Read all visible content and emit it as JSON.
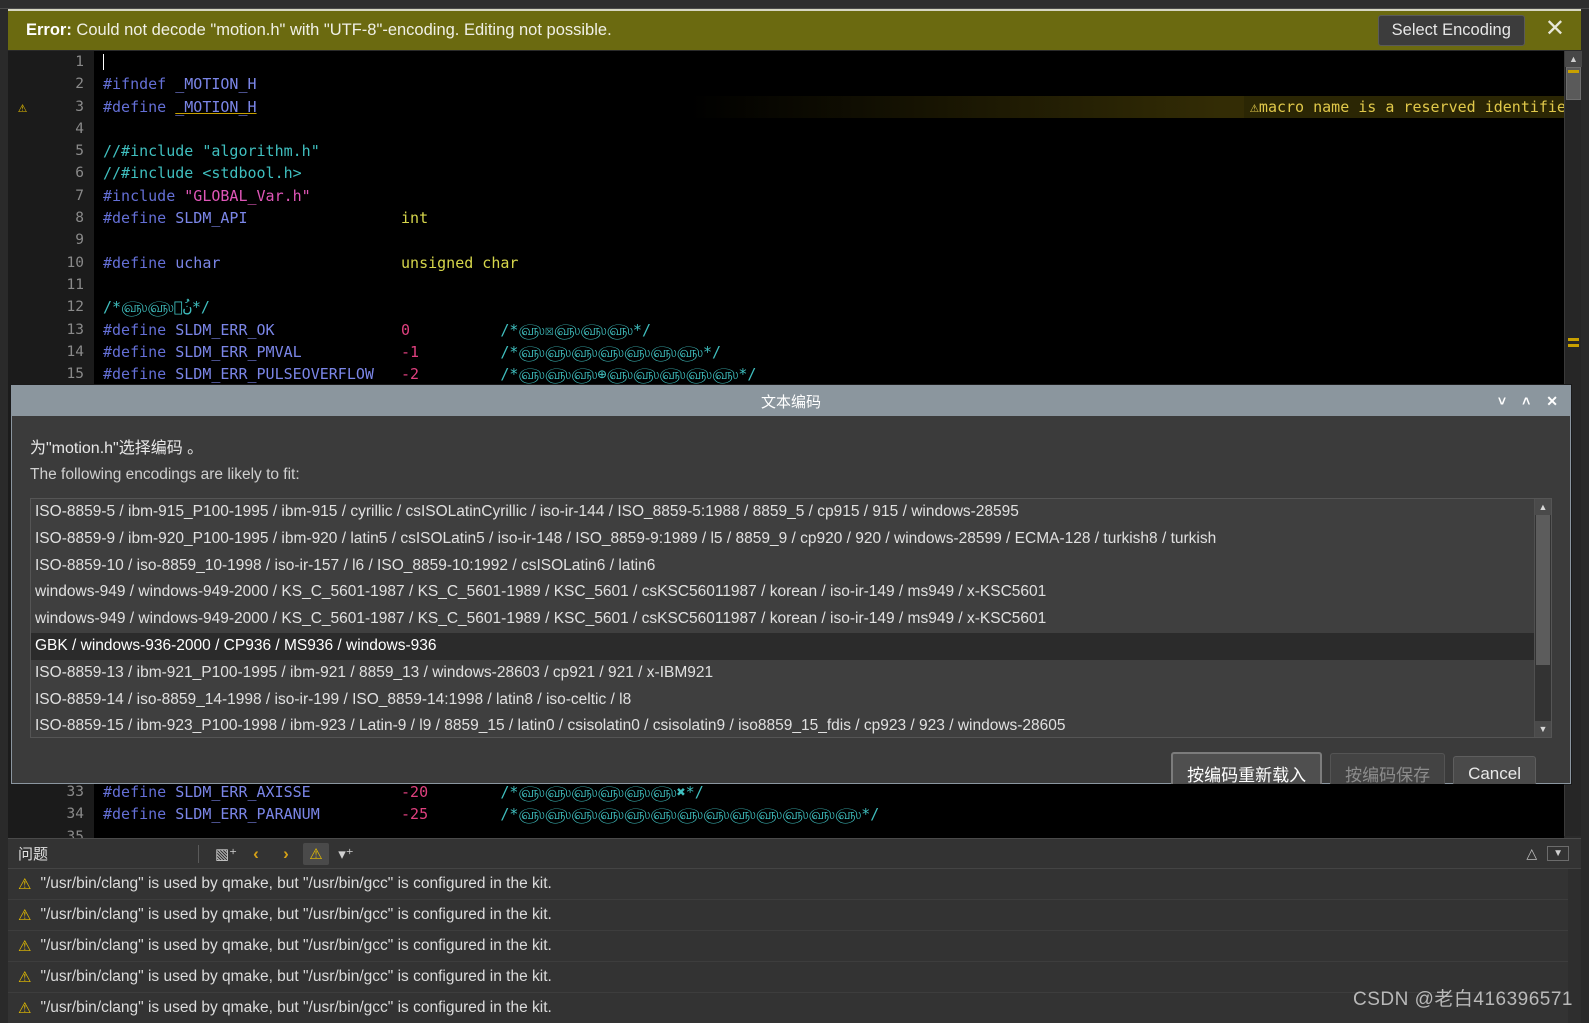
{
  "error_banner": {
    "prefix": "Error:",
    "message": " Could not decode \"motion.h\" with \"UTF-8\"-encoding. Editing not possible.",
    "select_encoding_label": "Select Encoding",
    "close_icon": "close-icon",
    "background_color": "#6b6a10"
  },
  "editor": {
    "inline_warning": "macro name is a reserved identifier",
    "warning_icon": "warning-triangle-icon",
    "lines": [
      {
        "num": "1",
        "warn": false,
        "segments": []
      },
      {
        "num": "2",
        "warn": false,
        "segments": [
          {
            "t": "#ifndef ",
            "c": "k-pre"
          },
          {
            "t": "_MOTION_H",
            "c": "k-mac"
          }
        ]
      },
      {
        "num": "3",
        "warn": true,
        "segments": [
          {
            "t": "#define ",
            "c": "k-pre"
          },
          {
            "t": "_MOTION_H",
            "c": "k-mac underline-warn"
          }
        ]
      },
      {
        "num": "4",
        "warn": false,
        "segments": []
      },
      {
        "num": "5",
        "warn": false,
        "segments": [
          {
            "t": "//#include ",
            "c": "k-cmt"
          },
          {
            "t": "\"algorithm.h\"",
            "c": "k-cmt"
          }
        ]
      },
      {
        "num": "6",
        "warn": false,
        "segments": [
          {
            "t": "//#include <stdbool.h>",
            "c": "k-cmt"
          }
        ]
      },
      {
        "num": "7",
        "warn": false,
        "segments": [
          {
            "t": "#include ",
            "c": "k-pre"
          },
          {
            "t": "\"GLOBAL_Var.h\"",
            "c": "k-str"
          }
        ]
      },
      {
        "num": "8",
        "warn": false,
        "segments": [
          {
            "t": "#define ",
            "c": "k-pre"
          },
          {
            "t": "SLDM_API",
            "c": "k-mac"
          },
          {
            "t": "                 ",
            "c": "k-plain"
          },
          {
            "t": "int",
            "c": "k-type"
          }
        ]
      },
      {
        "num": "9",
        "warn": false,
        "segments": []
      },
      {
        "num": "10",
        "warn": false,
        "segments": [
          {
            "t": "#define ",
            "c": "k-pre"
          },
          {
            "t": "uchar",
            "c": "k-mac"
          },
          {
            "t": "                    ",
            "c": "k-plain"
          },
          {
            "t": "unsigned char",
            "c": "k-type"
          }
        ]
      },
      {
        "num": "11",
        "warn": false,
        "segments": []
      },
      {
        "num": "12",
        "warn": false,
        "segments": [
          {
            "t": "/*௵௵௵ُن*/",
            "c": "k-cmt"
          }
        ]
      },
      {
        "num": "13",
        "warn": false,
        "segments": [
          {
            "t": "#define ",
            "c": "k-pre"
          },
          {
            "t": "SLDM_ERR_OK",
            "c": "k-mac"
          },
          {
            "t": "              ",
            "c": "k-plain"
          },
          {
            "t": "0",
            "c": "k-num"
          },
          {
            "t": "          ",
            "c": "k-plain"
          },
          {
            "t": "/*௵☒௵௵௵*/",
            "c": "k-cmt"
          }
        ]
      },
      {
        "num": "14",
        "warn": false,
        "segments": [
          {
            "t": "#define ",
            "c": "k-pre"
          },
          {
            "t": "SLDM_ERR_PMVAL",
            "c": "k-mac"
          },
          {
            "t": "           ",
            "c": "k-plain"
          },
          {
            "t": "-1",
            "c": "k-num"
          },
          {
            "t": "         ",
            "c": "k-plain"
          },
          {
            "t": "/*௵௵௵௵௵௵௵*/",
            "c": "k-cmt"
          }
        ]
      },
      {
        "num": "15",
        "warn": false,
        "segments": [
          {
            "t": "#define ",
            "c": "k-pre"
          },
          {
            "t": "SLDM_ERR_PULSEOVERFLOW",
            "c": "k-mac"
          },
          {
            "t": "   ",
            "c": "k-plain"
          },
          {
            "t": "-2",
            "c": "k-num"
          },
          {
            "t": "         ",
            "c": "k-plain"
          },
          {
            "t": "/*௵௵௵⊕௵௵௵௵௵*/",
            "c": "k-cmt"
          }
        ]
      }
    ],
    "lines_bottom": [
      {
        "num": "33",
        "segments": [
          {
            "t": "#define ",
            "c": "k-pre"
          },
          {
            "t": "SLDM_ERR_AXISSE",
            "c": "k-mac"
          },
          {
            "t": "          ",
            "c": "k-plain"
          },
          {
            "t": "-20",
            "c": "k-num"
          },
          {
            "t": "        ",
            "c": "k-plain"
          },
          {
            "t": "/*௵௵௵௵௵௵✖*/",
            "c": "k-cmt"
          }
        ]
      },
      {
        "num": "34",
        "segments": [
          {
            "t": "#define ",
            "c": "k-pre"
          },
          {
            "t": "SLDM_ERR_PARANUM",
            "c": "k-mac"
          },
          {
            "t": "         ",
            "c": "k-plain"
          },
          {
            "t": "-25",
            "c": "k-num"
          },
          {
            "t": "        ",
            "c": "k-plain"
          },
          {
            "t": "/*௵௵௵௵௵௵௵௵௵௵௵௵௵*/",
            "c": "k-cmt"
          }
        ]
      },
      {
        "num": "35",
        "segments": []
      }
    ]
  },
  "dialog": {
    "title": "文本编码",
    "minimize_icon": "chevron-down-icon",
    "maximize_icon": "chevron-up-icon",
    "close_icon": "close-icon",
    "line1": "为\"motion.h\"选择编码 。",
    "line2": "The following encodings are likely to fit:",
    "encodings": [
      {
        "label": "ISO-8859-5 / ibm-915_P100-1995 / ibm-915 / cyrillic / csISOLatinCyrillic / iso-ir-144 / ISO_8859-5:1988 / 8859_5 / cp915 / 915 / windows-28595",
        "selected": false
      },
      {
        "label": "ISO-8859-9 / ibm-920_P100-1995 / ibm-920 / latin5 / csISOLatin5 / iso-ir-148 / ISO_8859-9:1989 / l5 / 8859_9 / cp920 / 920 / windows-28599 / ECMA-128 / turkish8 / turkish",
        "selected": false
      },
      {
        "label": "ISO-8859-10 / iso-8859_10-1998 / iso-ir-157 / l6 / ISO_8859-10:1992 / csISOLatin6 / latin6",
        "selected": false
      },
      {
        "label": "windows-949 / windows-949-2000 / KS_C_5601-1987 / KS_C_5601-1989 / KSC_5601 / csKSC56011987 / korean / iso-ir-149 / ms949 / x-KSC5601",
        "selected": false
      },
      {
        "label": "windows-949 / windows-949-2000 / KS_C_5601-1987 / KS_C_5601-1989 / KSC_5601 / csKSC56011987 / korean / iso-ir-149 / ms949 / x-KSC5601",
        "selected": false
      },
      {
        "label": "GBK / windows-936-2000 / CP936 / MS936 / windows-936",
        "selected": true
      },
      {
        "label": "ISO-8859-13 / ibm-921_P100-1995 / ibm-921 / 8859_13 / windows-28603 / cp921 / 921 / x-IBM921",
        "selected": false
      },
      {
        "label": "ISO-8859-14 / iso-8859_14-1998 / iso-ir-199 / ISO_8859-14:1998 / latin8 / iso-celtic / l8",
        "selected": false
      },
      {
        "label": "ISO-8859-15 / ibm-923_P100-1998 / ibm-923 / Latin-9 / l9 / 8859_15 / latin0 / csisolatin0 / csisolatin9 / iso8859_15_fdis / cp923 / 923 / windows-28605",
        "selected": false
      }
    ],
    "buttons": {
      "reload": "按编码重新载入",
      "save": "按编码保存",
      "cancel": "Cancel"
    }
  },
  "problems_panel": {
    "title": "问题",
    "icons": {
      "filter_categories": "filter-categories-icon",
      "prev": "chevron-left-icon",
      "next": "chevron-right-icon",
      "warning_filter": "warning-triangle-icon",
      "filter": "funnel-icon",
      "collapse": "chevron-up-icon",
      "menu": "dropdown-box-icon"
    },
    "rows": [
      {
        "icon": "warning-triangle-icon",
        "text": "\"/usr/bin/clang\" is used by qmake, but \"/usr/bin/gcc\" is configured in the kit."
      },
      {
        "icon": "warning-triangle-icon",
        "text": "\"/usr/bin/clang\" is used by qmake, but \"/usr/bin/gcc\" is configured in the kit."
      },
      {
        "icon": "warning-triangle-icon",
        "text": "\"/usr/bin/clang\" is used by qmake, but \"/usr/bin/gcc\" is configured in the kit."
      },
      {
        "icon": "warning-triangle-icon",
        "text": "\"/usr/bin/clang\" is used by qmake, but \"/usr/bin/gcc\" is configured in the kit."
      },
      {
        "icon": "warning-triangle-icon",
        "text": "\"/usr/bin/clang\" is used by qmake, but \"/usr/bin/gcc\" is configured in the kit."
      }
    ]
  },
  "watermark": "CSDN @老白416396571"
}
